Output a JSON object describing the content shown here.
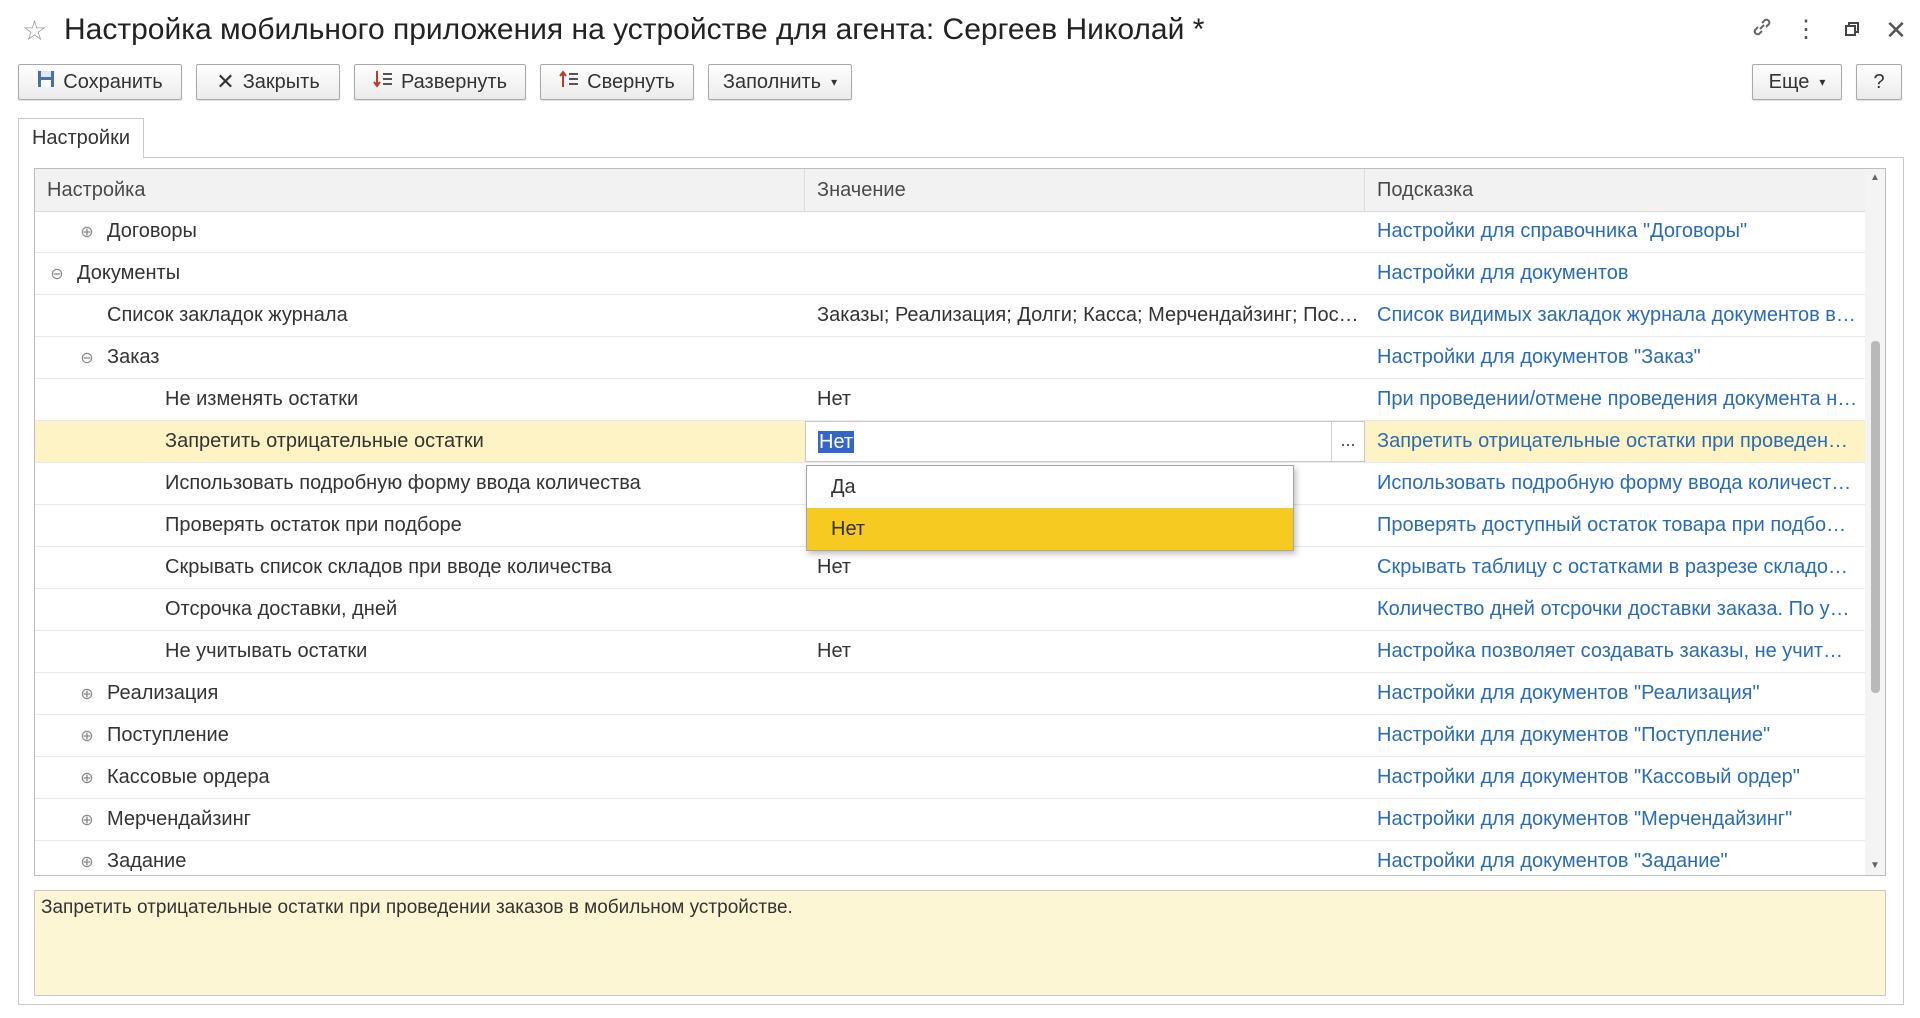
{
  "window": {
    "title": "Настройка мобильного приложения на устройстве для агента: Сергеев Николай *",
    "favorite_icon": "star-icon",
    "link_icon": "link-icon",
    "more_icon": "kebab-icon",
    "restore_icon": "restore-icon",
    "close_icon": "close-icon"
  },
  "toolbar": {
    "save_label": "Сохранить",
    "close_label": "Закрыть",
    "expand_label": "Развернуть",
    "collapse_label": "Свернуть",
    "fill_label": "Заполнить",
    "more_label": "Еще",
    "help_label": "?"
  },
  "tabs": [
    {
      "label": "Настройки"
    }
  ],
  "table": {
    "columns": [
      "Настройка",
      "Значение",
      "Подсказка"
    ],
    "rows": [
      {
        "setting": "Договоры",
        "value": "",
        "hint": "Настройки для справочника \"Договоры\"",
        "expander": "⊕",
        "level": 1
      },
      {
        "setting": "Документы",
        "value": "",
        "hint": "Настройки для документов",
        "expander": "⊖",
        "level": 0
      },
      {
        "setting": "Список закладок журнала",
        "value": "Заказы; Реализация; Долги; Касса; Мерчендайзинг; Пос…",
        "hint": "Список видимых закладок журнала документов в…",
        "expander": "",
        "level": 1
      },
      {
        "setting": "Заказ",
        "value": "",
        "hint": "Настройки для документов \"Заказ\"",
        "expander": "⊖",
        "level": 1
      },
      {
        "setting": "Не изменять остатки",
        "value": "Нет",
        "hint": "При проведении/отмене проведения документа н…",
        "expander": "",
        "level": 2
      },
      {
        "setting": "Запретить отрицательные остатки",
        "value": "Нет",
        "hint": "Запретить отрицательные остатки при проведен…",
        "expander": "",
        "level": 2,
        "selected": true
      },
      {
        "setting": "Использовать подробную форму ввода количества",
        "value": "",
        "hint": "Использовать подробную форму ввода количест…",
        "expander": "",
        "level": 2
      },
      {
        "setting": "Проверять остаток при подборе",
        "value": "",
        "hint": "Проверять доступный остаток товара при подбо…",
        "expander": "",
        "level": 2
      },
      {
        "setting": "Скрывать список складов при вводе количества",
        "value": "Нет",
        "hint": "Скрывать таблицу с остатками в разрезе складо…",
        "expander": "",
        "level": 2
      },
      {
        "setting": "Отсрочка доставки, дней",
        "value": "",
        "hint": "Количество дней отсрочки доставки заказа. По у…",
        "expander": "",
        "level": 2
      },
      {
        "setting": "Не учитывать остатки",
        "value": "Нет",
        "hint": "Настройка позволяет создавать заказы, не учит…",
        "expander": "",
        "level": 2
      },
      {
        "setting": "Реализация",
        "value": "",
        "hint": "Настройки для документов \"Реализация\"",
        "expander": "⊕",
        "level": 1
      },
      {
        "setting": "Поступление",
        "value": "",
        "hint": "Настройки для документов \"Поступление\"",
        "expander": "⊕",
        "level": 1
      },
      {
        "setting": "Кассовые ордера",
        "value": "",
        "hint": "Настройки для документов \"Кассовый ордер\"",
        "expander": "⊕",
        "level": 1
      },
      {
        "setting": "Мерчендайзинг",
        "value": "",
        "hint": "Настройки для документов \"Мерчендайзинг\"",
        "expander": "⊕",
        "level": 1
      },
      {
        "setting": "Задание",
        "value": "",
        "hint": "Настройки для документов \"Задание\"",
        "expander": "⊕",
        "level": 1
      }
    ]
  },
  "editor": {
    "current_value": "Нет",
    "choice_button": "...",
    "options": [
      "Да",
      "Нет"
    ],
    "highlighted_option": "Нет"
  },
  "hint_panel": {
    "text": "Запретить отрицательные остатки при проведении заказов в мобильном устройстве."
  },
  "colors": {
    "selected_row": "#fdf3c4",
    "hint_link": "#2a6cb3",
    "dropdown_highlight": "#f6ca21",
    "hint_panel_bg": "#fcf6d5"
  }
}
